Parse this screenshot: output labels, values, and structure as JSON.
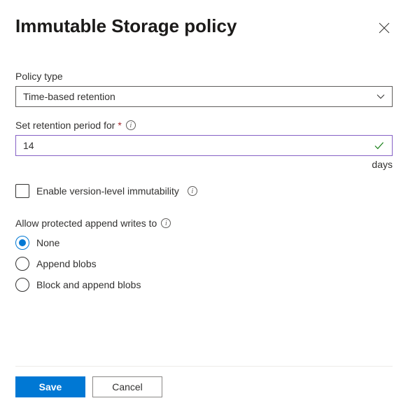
{
  "header": {
    "title": "Immutable Storage policy"
  },
  "policyType": {
    "label": "Policy type",
    "value": "Time-based retention"
  },
  "retention": {
    "label": "Set retention period for",
    "value": "14",
    "unit": "days"
  },
  "versionLevel": {
    "label": "Enable version-level immutability",
    "checked": false
  },
  "appendWrites": {
    "label": "Allow protected append writes to",
    "options": [
      {
        "label": "None",
        "selected": true
      },
      {
        "label": "Append blobs",
        "selected": false
      },
      {
        "label": "Block and append blobs",
        "selected": false
      }
    ]
  },
  "footer": {
    "save": "Save",
    "cancel": "Cancel"
  }
}
